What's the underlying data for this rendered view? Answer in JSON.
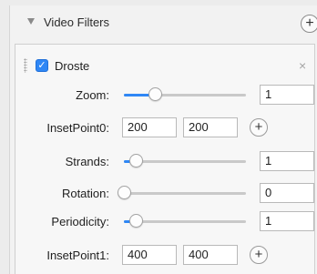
{
  "header": {
    "title": "Video Filters",
    "add_label": "+"
  },
  "filter": {
    "name": "Droste",
    "enabled": true,
    "close_label": "×",
    "params": {
      "zoom": {
        "label": "Zoom:",
        "value": "1",
        "slider_fraction": 0.25
      },
      "inset0": {
        "label": "InsetPoint0:",
        "x": "200",
        "y": "200",
        "add_label": "+"
      },
      "strands": {
        "label": "Strands:",
        "value": "1",
        "slider_fraction": 0.1
      },
      "rotation": {
        "label": "Rotation:",
        "value": "0",
        "slider_fraction": 0.0
      },
      "periodicity": {
        "label": "Periodicity:",
        "value": "1",
        "slider_fraction": 0.1
      },
      "inset1": {
        "label": "InsetPoint1:",
        "x": "400",
        "y": "400",
        "add_label": "+"
      }
    }
  },
  "colors": {
    "accent": "#2f87f5",
    "track": "#c9c9c9"
  },
  "icons": {
    "disclosure": "disclosure-triangle-icon",
    "grip": "drag-handle-icon",
    "close": "close-icon"
  }
}
